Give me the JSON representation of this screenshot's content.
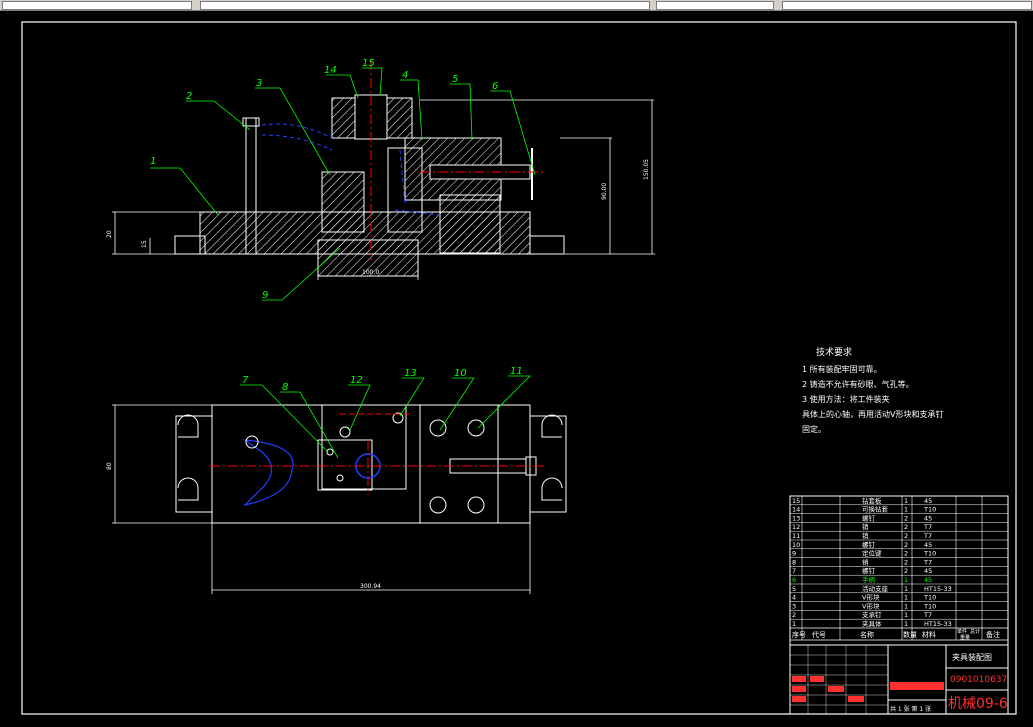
{
  "drawing": {
    "part_numbers": [
      "1",
      "2",
      "3",
      "4",
      "5",
      "6",
      "7",
      "8",
      "9",
      "10",
      "11",
      "12",
      "13",
      "14",
      "15"
    ],
    "dims": {
      "total_height": "150.05",
      "upper_height": "90.00",
      "base_height": "20",
      "step": "15",
      "base_width": "100.0",
      "plan_length": "300.94",
      "plan_width": "80"
    }
  },
  "tech_requirements": {
    "title": "技术要求",
    "lines": [
      "1  所有装配牢固可靠。",
      "2  铸造不允许有砂眼、气孔等。",
      "3  使用方法：将工件装夹",
      "具体上的心轴，再用活动V形块和支承钉",
      "固定。"
    ]
  },
  "bom": {
    "headers": {
      "seq": "序号",
      "code": "代号",
      "name": "名称",
      "qty": "数量",
      "material": "材料",
      "unit_weight": "单件",
      "total_weight": "总计",
      "weight": "重量",
      "remark": "备注"
    },
    "rows": [
      {
        "no": "15",
        "name": "钻套板",
        "qty": "1",
        "mat": "45"
      },
      {
        "no": "14",
        "name": "可换钻套",
        "qty": "1",
        "mat": "T10"
      },
      {
        "no": "13",
        "name": "螺钉",
        "qty": "2",
        "mat": "45"
      },
      {
        "no": "12",
        "name": "销",
        "qty": "2",
        "mat": "T7"
      },
      {
        "no": "11",
        "name": "销",
        "qty": "2",
        "mat": "T7"
      },
      {
        "no": "10",
        "name": "螺钉",
        "qty": "2",
        "mat": "45"
      },
      {
        "no": "9",
        "name": "定位键",
        "qty": "2",
        "mat": "T10"
      },
      {
        "no": "8",
        "name": "销",
        "qty": "2",
        "mat": "T7"
      },
      {
        "no": "7",
        "name": "螺钉",
        "qty": "2",
        "mat": "45"
      },
      {
        "no": "6",
        "name": "手柄",
        "qty": "1",
        "mat": "45"
      },
      {
        "no": "5",
        "name": "活动支座",
        "qty": "1",
        "mat": "HT15-33"
      },
      {
        "no": "4",
        "name": "V形块",
        "qty": "1",
        "mat": "T10"
      },
      {
        "no": "3",
        "name": "V形块",
        "qty": "1",
        "mat": "T10"
      },
      {
        "no": "2",
        "name": "支承钉",
        "qty": "1",
        "mat": "T7"
      },
      {
        "no": "1",
        "name": "夹具体",
        "qty": "1",
        "mat": "HT15-33"
      }
    ]
  },
  "title_block": {
    "drawing_name": "夹具装配图",
    "drawing_number": "0901010637",
    "school": "机械09-6",
    "sheet": "共 1 张  第 1 张"
  },
  "colors": {
    "bg": "#000000",
    "line": "#ffffff",
    "hatch": "#ffffff",
    "center": "#ff0000",
    "hidden": "#2040ff",
    "leader": "#00ff00",
    "dim": "#ffffff",
    "title_red": "#ff3030"
  }
}
